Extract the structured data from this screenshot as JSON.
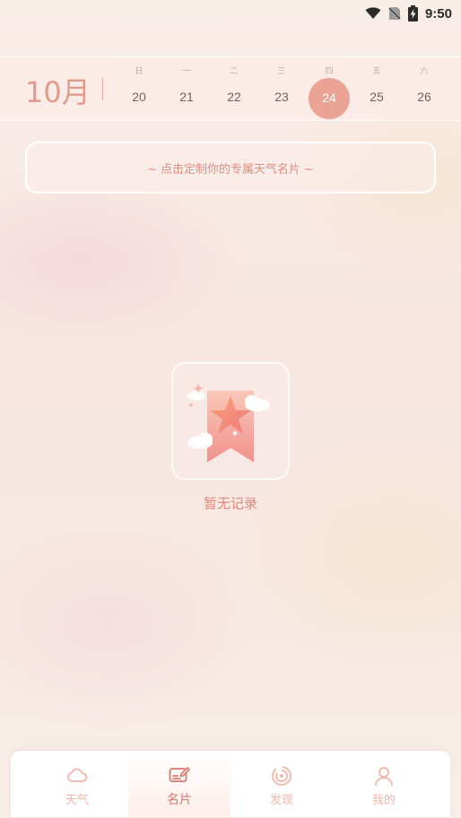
{
  "status_bar": {
    "time": "9:50",
    "icons": [
      "wifi-icon",
      "no-sim-icon",
      "battery-charging-icon"
    ]
  },
  "calendar": {
    "month_label": "10月",
    "days": [
      {
        "weekday": "日",
        "date": "20",
        "selected": false
      },
      {
        "weekday": "一",
        "date": "21",
        "selected": false
      },
      {
        "weekday": "二",
        "date": "22",
        "selected": false
      },
      {
        "weekday": "三",
        "date": "23",
        "selected": false
      },
      {
        "weekday": "四",
        "date": "24",
        "selected": true
      },
      {
        "weekday": "五",
        "date": "25",
        "selected": false
      },
      {
        "weekday": "六",
        "date": "26",
        "selected": false
      }
    ]
  },
  "customize_card": {
    "text": "~ 点击定制你的专属天气名片 ~"
  },
  "empty_state": {
    "icon": "empty-bookmark-star-icon",
    "text": "暂无记录"
  },
  "tab_bar": {
    "tabs": [
      {
        "label": "天气",
        "icon": "cloud-icon",
        "active": false
      },
      {
        "label": "名片",
        "icon": "card-edit-icon",
        "active": true
      },
      {
        "label": "发现",
        "icon": "discover-icon",
        "active": false
      },
      {
        "label": "我的",
        "icon": "person-icon",
        "active": false
      }
    ]
  },
  "colors": {
    "accent": "#eba396",
    "text_accent": "#e08c7e",
    "tab_inactive": "#f4b4a8",
    "tab_active": "#d9786a"
  }
}
